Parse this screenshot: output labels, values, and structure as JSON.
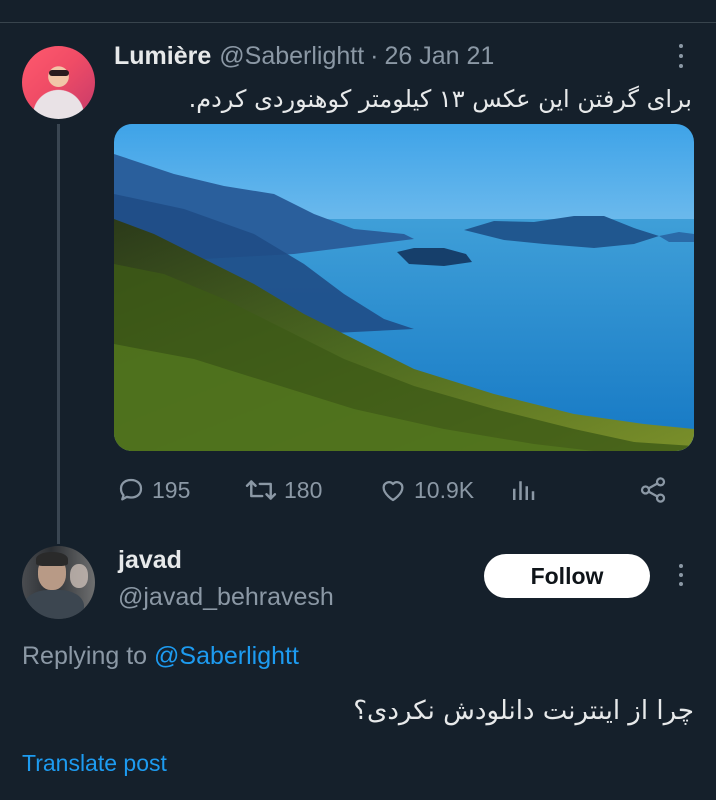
{
  "tweet": {
    "author_name": "Lumière",
    "author_handle": "@Saberlightt",
    "separator": "·",
    "date": "26 Jan 21",
    "text": "برای گرفتن این عکس ۱۳ کیلومتر کوهنوردی کردم.",
    "image_alt": "aerial view of forested mountain slope above a blue sound with islands",
    "stats": {
      "replies": "195",
      "retweets": "180",
      "likes": "10.9K"
    }
  },
  "reply": {
    "author_name": "javad",
    "author_handle": "@javad_behravesh",
    "follow_label": "Follow",
    "replying_prefix": "Replying to",
    "replying_to": "@Saberlightt",
    "text": "چرا از اینترنت دانلودش نکردی؟",
    "translate_label": "Translate post"
  },
  "icons": {
    "reply": "reply-icon",
    "retweet": "retweet-icon",
    "like": "heart-icon",
    "views": "analytics-icon",
    "share": "share-icon",
    "more": "more-icon"
  },
  "colors": {
    "background": "#15202b",
    "text": "#e7e9ea",
    "secondary": "#8b98a5",
    "accent": "#1d9bf0",
    "follow_bg": "#ffffff"
  }
}
